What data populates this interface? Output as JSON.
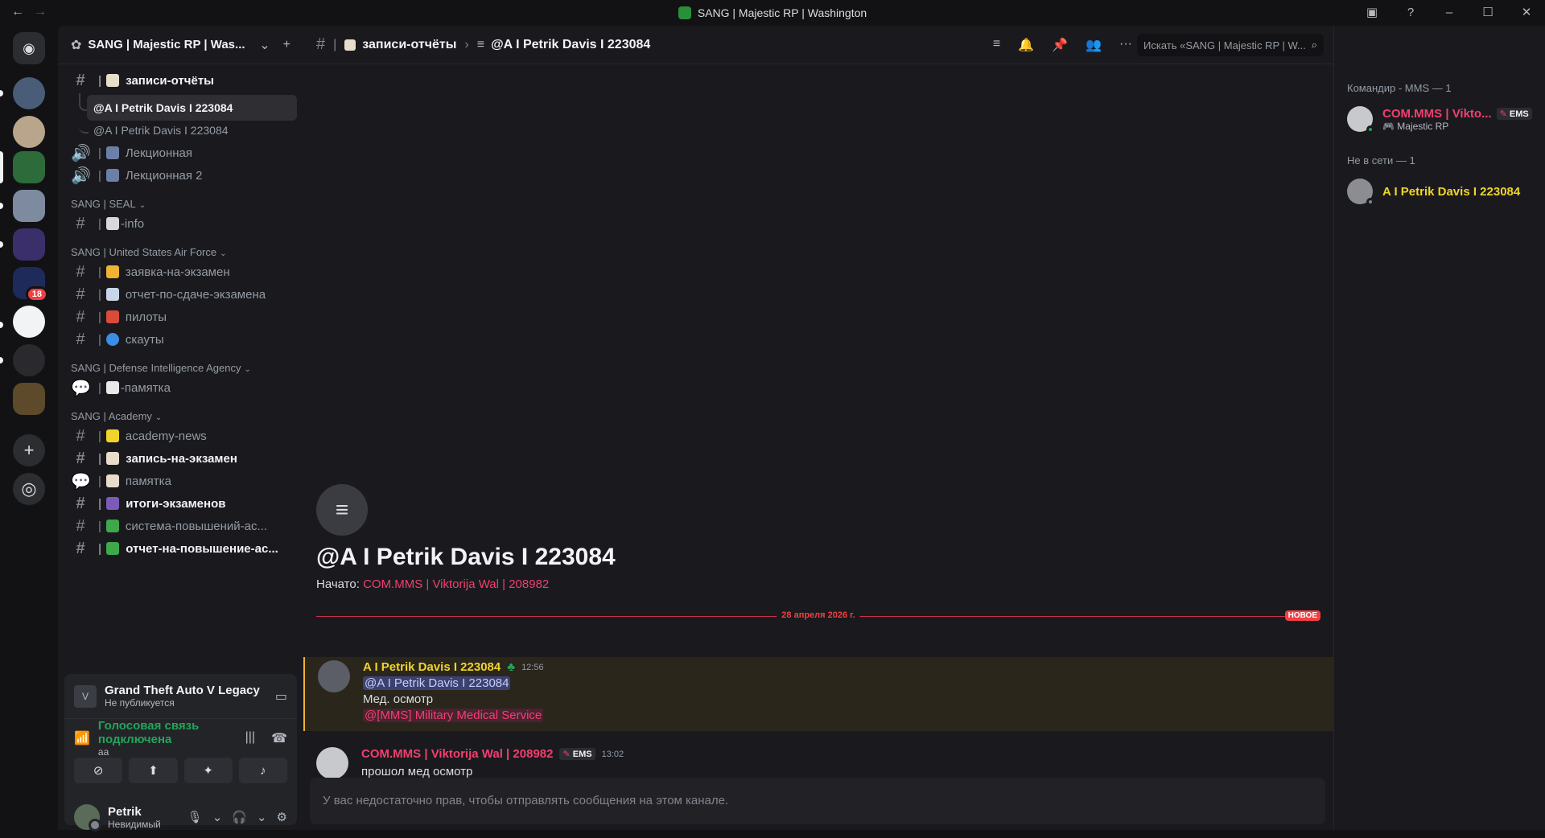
{
  "titlebar": {
    "title": "SANG | Majestic RP | Washington",
    "back": "←",
    "forward": "→"
  },
  "server": {
    "name": "SANG | Majestic RP | Was...",
    "badge_count": "18"
  },
  "channels": [
    {
      "name": "записи-отчёты",
      "type": "text",
      "unread": true
    },
    {
      "name": "@A I Petrik Davis I 223084",
      "type": "thread",
      "active": true
    },
    {
      "name": "@A I Petrik Davis I 223084",
      "type": "thread"
    },
    {
      "name": "Лекционная",
      "type": "voice"
    },
    {
      "name": "Лекционная 2",
      "type": "voice"
    }
  ],
  "categories": {
    "seal": "SANG | SEAL",
    "usaf": "SANG | United States Air Force",
    "dia": "SANG | Defense Intelligence Agency",
    "academy": "SANG | Academy"
  },
  "seal_channels": [
    "-info"
  ],
  "usaf_channels": [
    "заявка-на-экзамен",
    "отчет-по-сдаче-экзамена",
    "пилоты",
    "скауты"
  ],
  "dia_channels": [
    "-памятка"
  ],
  "academy_channels": [
    "academy-news",
    "запись-на-экзамен",
    "памятка",
    "итоги-экзаменов",
    "система-повышений-ас...",
    "отчет-на-повышение-ас..."
  ],
  "activity": {
    "game": "Grand Theft Auto V Legacy",
    "game_sub": "Не публикуется",
    "voice_status": "Голосовая связь подключена",
    "voice_sub": "aa"
  },
  "user": {
    "name": "Petrik",
    "status": "Невидимый"
  },
  "header": {
    "channel": "записи-отчёты",
    "thread": "@A I Petrik Davis I 223084",
    "search_placeholder": "Искать «SANG | Majestic RP | W..."
  },
  "thread_start": {
    "title": "@A I Petrik Davis I 223084",
    "started_label": "Начато:",
    "started_by": "COM.MMS | Viktorija Wal | 208982"
  },
  "divider": {
    "date": "28 апреля 2026 г.",
    "new_label": "НОВОЕ"
  },
  "messages": [
    {
      "author": "A I Petrik Davis I 223084",
      "time": "12:56",
      "mention": "@A I Petrik Davis I 223084",
      "text": "Мед. осмотр",
      "role_mention": "@[MMS] Military Medical Service"
    },
    {
      "author": "COM.MMS | Viktorija Wal | 208982",
      "tag": "EMS",
      "time": "13:02",
      "text": "прошол мед осмотр"
    }
  ],
  "composer": {
    "text": "У вас недостаточно прав, чтобы отправлять сообщения на этом канале."
  },
  "members": {
    "group1": "Командир - MMS — 1",
    "m1_name": "COM.MMS | Vikto...",
    "m1_tag": "EMS",
    "m1_sub": "Majestic RP",
    "group2": "Не в сети — 1",
    "m2_name": "A I Petrik Davis I 223084"
  },
  "colors": {
    "accent_pink": "#f23f6f",
    "accent_yellow": "#f0d42b",
    "online": "#23a55a"
  }
}
